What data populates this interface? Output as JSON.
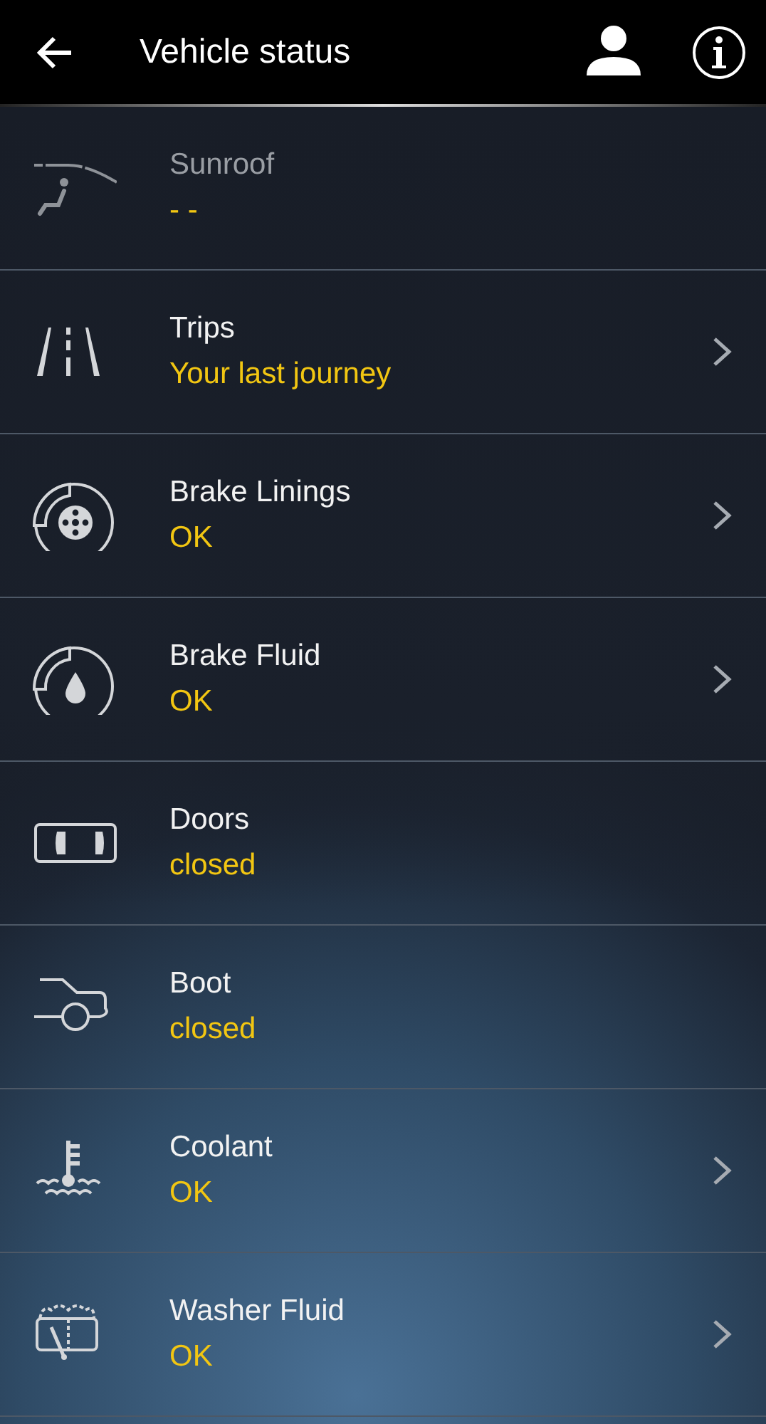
{
  "header": {
    "title": "Vehicle status"
  },
  "items": [
    {
      "kind": "sunroof",
      "title": "Sunroof",
      "status": "- -",
      "disabled": true,
      "chevron": false
    },
    {
      "kind": "trips",
      "title": "Trips",
      "status": "Your last journey",
      "disabled": false,
      "chevron": true
    },
    {
      "kind": "brake-linings",
      "title": "Brake Linings",
      "status": "OK",
      "disabled": false,
      "chevron": true
    },
    {
      "kind": "brake-fluid",
      "title": "Brake Fluid",
      "status": "OK",
      "disabled": false,
      "chevron": true
    },
    {
      "kind": "doors",
      "title": "Doors",
      "status": "closed",
      "disabled": false,
      "chevron": false
    },
    {
      "kind": "boot",
      "title": "Boot",
      "status": "closed",
      "disabled": false,
      "chevron": false
    },
    {
      "kind": "coolant",
      "title": "Coolant",
      "status": "OK",
      "disabled": false,
      "chevron": true
    },
    {
      "kind": "washer",
      "title": "Washer Fluid",
      "status": "OK",
      "disabled": false,
      "chevron": true
    }
  ]
}
